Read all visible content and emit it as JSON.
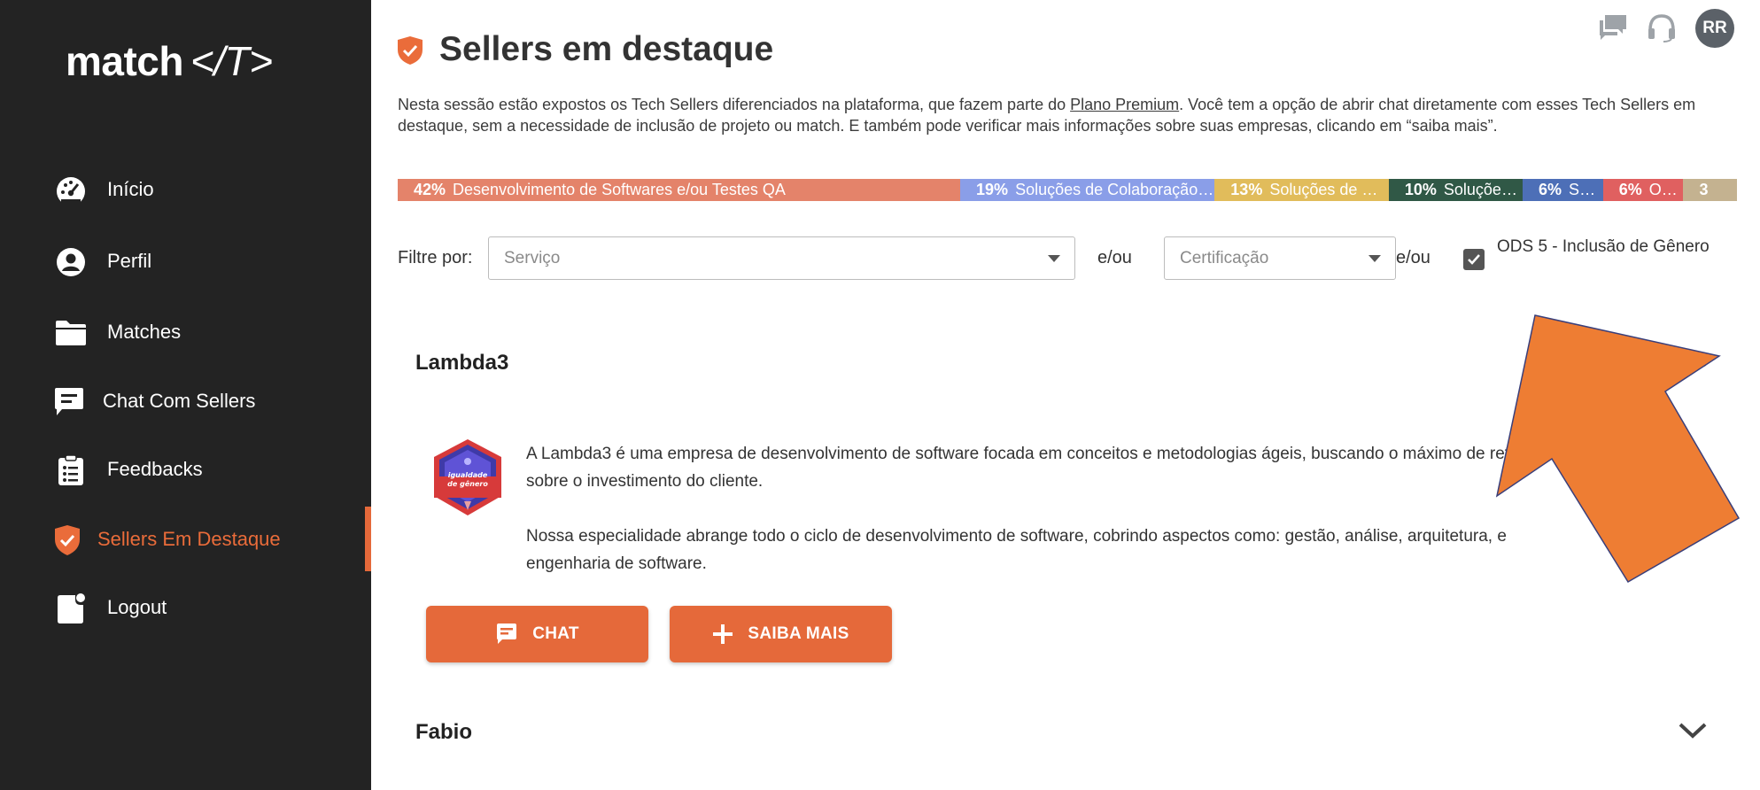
{
  "app": {
    "logo_main": "match",
    "logo_accent": "</T>"
  },
  "sidebar": {
    "items": [
      {
        "label": "Início",
        "icon": "speedometer-icon"
      },
      {
        "label": "Perfil",
        "icon": "user-circle-icon"
      },
      {
        "label": "Matches",
        "icon": "folder-icon"
      },
      {
        "label": "Chat Com Sellers",
        "icon": "chat-icon"
      },
      {
        "label": "Feedbacks",
        "icon": "clipboard-list-icon"
      },
      {
        "label": "Sellers Em Destaque",
        "icon": "shield-check-icon",
        "active": true
      },
      {
        "label": "Logout",
        "icon": "logout-icon"
      }
    ]
  },
  "header": {
    "avatar_initials": "RR",
    "icons": [
      "chat-bubbles-icon",
      "headset-icon"
    ]
  },
  "page": {
    "title": "Sellers em destaque",
    "intro_part1": "Nesta sessão estão expostos os Tech Sellers diferenciados na plataforma, que fazem parte do ",
    "intro_link": "Plano Premium",
    "intro_part2": ".  Você tem a opção de abrir chat diretamente com esses Tech Sellers em destaque, sem a necessidade de inclusão de projeto ou match. E também pode verificar mais informações sobre suas empresas, clicando em “saiba mais”."
  },
  "distribution": [
    {
      "pct": "42%",
      "label": "Desenvolvimento de Softwares e/ou Testes QA",
      "value": 42,
      "color": "#e4836a"
    },
    {
      "pct": "19%",
      "label": "Soluções de Colaboração e Comunicação",
      "value": 19,
      "color": "#8a9ee8"
    },
    {
      "pct": "13%",
      "label": "Soluções de Dados",
      "value": 13,
      "color": "#e1bc5b"
    },
    {
      "pct": "10%",
      "label": "Soluções em Nuvem",
      "value": 10,
      "color": "#305846"
    },
    {
      "pct": "6%",
      "label": "Segurança",
      "value": 6,
      "color": "#4d6fb7"
    },
    {
      "pct": "6%",
      "label": "Outros",
      "value": 6,
      "color": "#e06060"
    },
    {
      "pct": "3",
      "label": "",
      "value": 4,
      "color": "#c4b290"
    }
  ],
  "filters": {
    "label": "Filtre por:",
    "service_placeholder": "Serviço",
    "or1": "e/ou",
    "certification_placeholder": "Certificação",
    "or2": "e/ou",
    "ods_checkbox_label": "ODS 5 - Inclusão de Gênero",
    "ods_checked": true
  },
  "sellers": [
    {
      "name": "Lambda3",
      "badge_text": "igualdade de gênero",
      "desc_p1": "A Lambda3 é uma empresa de desenvolvimento de software focada em conceitos e metodologias ágeis, buscando o máximo de retorno sobre o investimento do cliente.",
      "desc_p2": "Nossa especialidade abrange todo o ciclo de desenvolvimento de software, cobrindo aspectos como: gestão, análise, arquitetura, e engenharia de software.",
      "chat_label": "CHAT",
      "more_label": "SAIBA MAIS"
    },
    {
      "name": "Fabio"
    }
  ],
  "colors": {
    "accent": "#e5693a",
    "sidebar_bg": "#232323",
    "annotation_arrow": "#ee7d33"
  }
}
